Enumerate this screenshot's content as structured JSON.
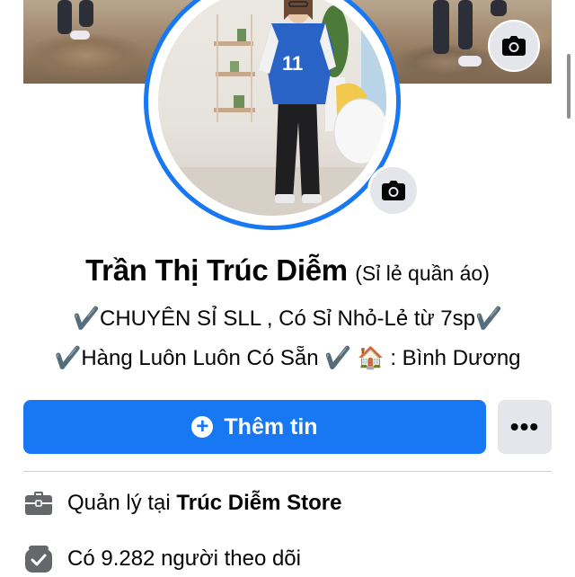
{
  "profile": {
    "name": "Trần Thị Trúc Diễm",
    "alternate_name": "(Sỉ lẻ quần áo)",
    "bio_line_1": "✔️CHUYÊN SỈ SLL , Có Sỉ Nhỏ-Lẻ từ 7sp✔️",
    "bio_line_2": "✔️Hàng Luôn Luôn Có Sẵn ✔️  🏠 : Bình Dương",
    "jersey_number": "11"
  },
  "actions": {
    "add_info_label": "Thêm tin",
    "more_label": "•••"
  },
  "info": {
    "manage_prefix": "Quản lý tại ",
    "manage_page": "Trúc Diễm Store",
    "followers_text": "Có 9.282 người theo dõi"
  },
  "icons": {
    "cover_camera": "camera-icon",
    "avatar_camera": "camera-icon",
    "add": "plus-circle-icon",
    "briefcase": "briefcase-icon",
    "followers": "followers-check-icon"
  },
  "colors": {
    "accent": "#1877f2",
    "secondary_button": "#e4e6eb",
    "divider": "#ced0d4",
    "text": "#050505"
  }
}
